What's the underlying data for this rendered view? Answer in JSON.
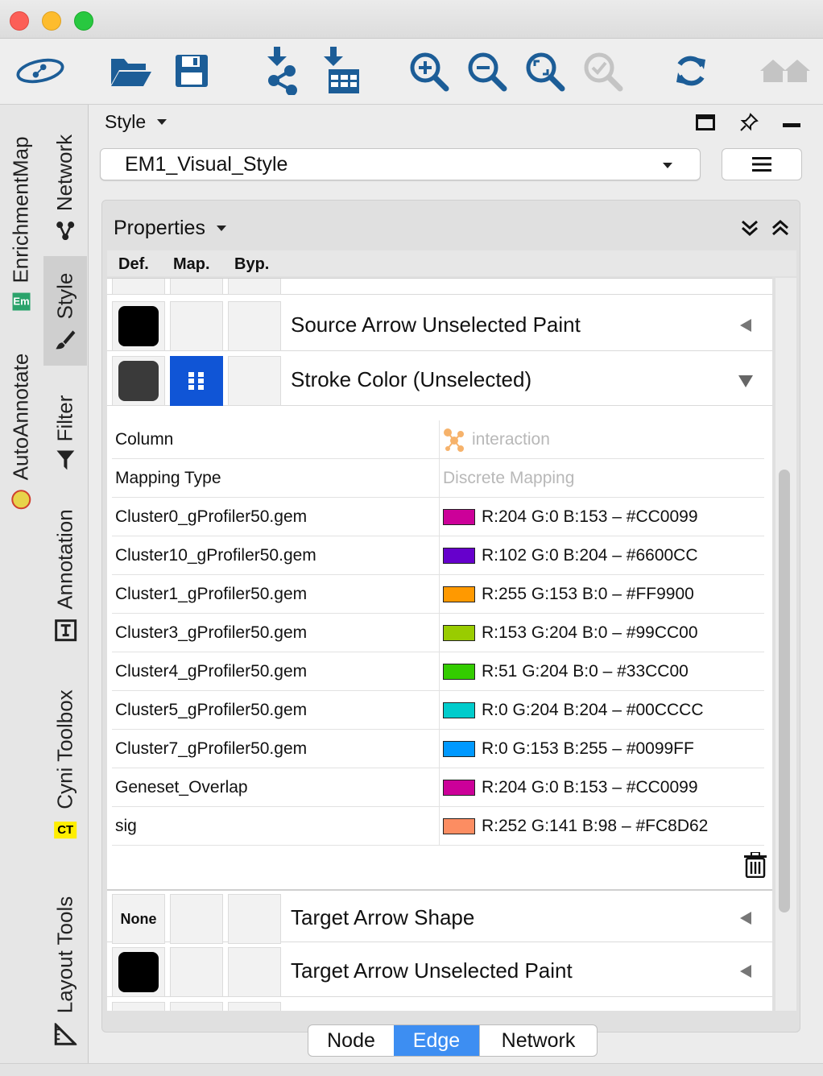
{
  "toolbar": {
    "icons": [
      "cytoscape-logo-icon",
      "open-session-icon",
      "save-session-icon",
      "import-network-icon",
      "import-table-icon",
      "zoom-in-icon",
      "zoom-out-icon",
      "zoom-fit-icon",
      "zoom-selected-icon",
      "refresh-icon",
      "home-icon"
    ]
  },
  "sidebar": {
    "tabs": [
      {
        "label": "EnrichmentMap",
        "icon": "em-icon"
      },
      {
        "label": "Network",
        "icon": "network-icon"
      },
      {
        "label": "Style",
        "icon": "brush-icon",
        "active": true
      },
      {
        "label": "AutoAnnotate",
        "icon": "autoannotate-icon"
      },
      {
        "label": "Filter",
        "icon": "filter-icon"
      },
      {
        "label": "Annotation",
        "icon": "annotation-icon"
      },
      {
        "label": "Cyni Toolbox",
        "icon": "ct-icon",
        "badge": "CT"
      },
      {
        "label": "Layout Tools",
        "icon": "ruler-icon"
      }
    ]
  },
  "panel": {
    "title": "Style",
    "style_selector": "EM1_Visual_Style"
  },
  "properties": {
    "title": "Properties",
    "col_def": "Def.",
    "col_map": "Map.",
    "col_byp": "Byp.",
    "rows": {
      "source_arrow_paint": "Source Arrow Unselected Paint",
      "stroke_color": "Stroke Color (Unselected)",
      "target_arrow_shape": "Target Arrow Shape",
      "target_arrow_shape_def": "None",
      "target_arrow_paint": "Target Arrow Unselected Paint"
    },
    "mapping": {
      "column_label": "Column",
      "column_value": "interaction",
      "type_label": "Mapping Type",
      "type_value": "Discrete Mapping",
      "entries": [
        {
          "key": "Cluster0_gProfiler50.gem",
          "value": "R:204 G:0 B:153 – #CC0099",
          "color": "#CC0099"
        },
        {
          "key": "Cluster10_gProfiler50.gem",
          "value": "R:102 G:0 B:204 – #6600CC",
          "color": "#6600CC"
        },
        {
          "key": "Cluster1_gProfiler50.gem",
          "value": "R:255 G:153 B:0 – #FF9900",
          "color": "#FF9900"
        },
        {
          "key": "Cluster3_gProfiler50.gem",
          "value": "R:153 G:204 B:0 – #99CC00",
          "color": "#99CC00"
        },
        {
          "key": "Cluster4_gProfiler50.gem",
          "value": "R:51 G:204 B:0 – #33CC00",
          "color": "#33CC00"
        },
        {
          "key": "Cluster5_gProfiler50.gem",
          "value": "R:0 G:204 B:204 – #00CCCC",
          "color": "#00CCCC"
        },
        {
          "key": "Cluster7_gProfiler50.gem",
          "value": "R:0 G:153 B:255 – #0099FF",
          "color": "#0099FF"
        },
        {
          "key": "Geneset_Overlap",
          "value": "R:204 G:0 B:153 – #CC0099",
          "color": "#CC0099"
        },
        {
          "key": "sig",
          "value": "R:252 G:141 B:98 – #FC8D62",
          "color": "#FC8D62"
        }
      ]
    }
  },
  "tabs_bottom": {
    "node": "Node",
    "edge": "Edge",
    "network": "Network",
    "active": "Edge"
  },
  "colors": {
    "accent": "#3d8ef2",
    "mapping_button": "#1055d6",
    "toolbar_icon": "#1c5d97"
  }
}
